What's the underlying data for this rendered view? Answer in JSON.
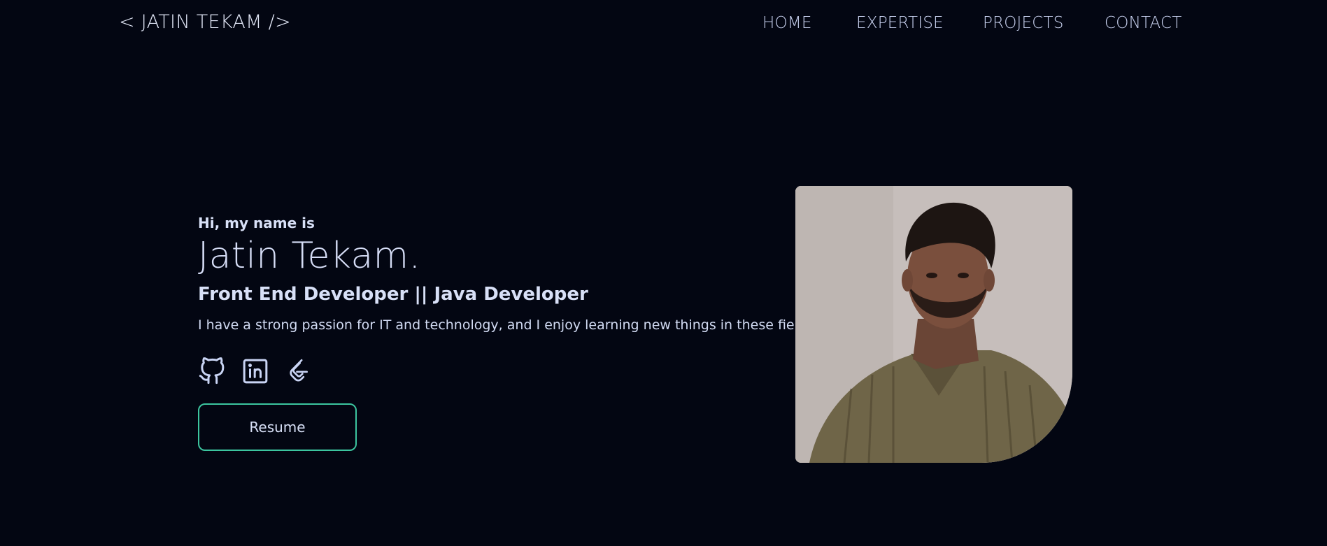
{
  "header": {
    "logo": "< JATIN TEKAM />",
    "nav": [
      {
        "label": "HOME"
      },
      {
        "label": "EXPERTISE"
      },
      {
        "label": "PROJECTS"
      },
      {
        "label": "CONTACT"
      }
    ]
  },
  "hero": {
    "greeting": "Hi, my name is",
    "name": "Jatin Tekam.",
    "role": "Front End Developer || Java Developer",
    "tagline": "I have a strong passion for IT and technology, and I enjoy learning new things in these fields.",
    "socials": [
      {
        "icon": "github-icon"
      },
      {
        "icon": "linkedin-icon"
      },
      {
        "icon": "leetcode-icon"
      }
    ],
    "resume_label": "Resume"
  },
  "colors": {
    "background": "#030612",
    "text": "#d4dcf2",
    "accent": "#3cc59f"
  }
}
